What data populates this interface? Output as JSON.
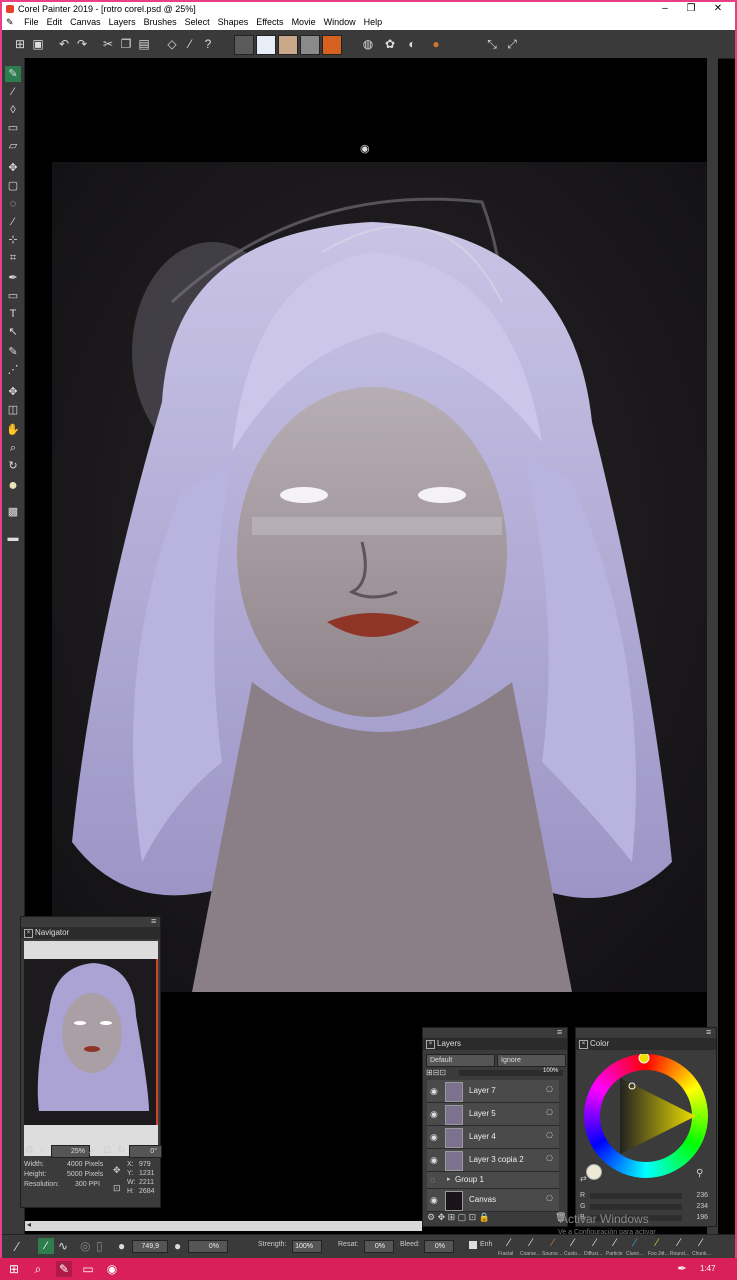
{
  "window": {
    "title": "Corel Painter 2019 - [rotro corel.psd @ 25%]",
    "controls": {
      "minimize": "–",
      "restore": "❐",
      "close": "✕"
    }
  },
  "menu": [
    "File",
    "Edit",
    "Canvas",
    "Layers",
    "Brushes",
    "Select",
    "Shapes",
    "Effects",
    "Movie",
    "Window",
    "Help"
  ],
  "colors": {
    "frame": "#e83f86",
    "taskbar": "#d9205b",
    "panel": "#3b3b3b",
    "accent_brush": "#2e7d4f"
  },
  "toolbar_icons": [
    "new-icon",
    "save-icon",
    "undo-icon",
    "redo-icon",
    "cut-icon",
    "copy-icon",
    "paste-icon",
    "eraser-icon",
    "brush-icon",
    "help-icon",
    "paper-icon",
    "media-icon",
    "texture-icon",
    "pattern-icon",
    "gradient-icon",
    "flow-icon",
    "weave-icon",
    "look-icon",
    "nozzle-icon",
    "mirror-icon",
    "symmetry-icon"
  ],
  "navigator": {
    "title": "Navigator",
    "zoom": "25%",
    "rotation": "0°",
    "width_label": "Width:",
    "width_value": "4000 Pixels",
    "height_label": "Height:",
    "height_value": "5000 Pixels",
    "resolution_label": "Resolution:",
    "resolution_value": "300 PPI",
    "x_label": "X:",
    "x_value": "979",
    "y_label": "Y:",
    "y_value": "1231",
    "w_label": "W:",
    "w_value": "2211",
    "h_label": "H:",
    "h_value": "2684"
  },
  "layers": {
    "title": "Layers",
    "blend_mode": "Default",
    "composite": "Ignore",
    "opacity": "100%",
    "items": [
      {
        "name": "Layer 7"
      },
      {
        "name": "Layer 5"
      },
      {
        "name": "Layer 4"
      },
      {
        "name": "Layer 3 copia 2"
      },
      {
        "name": "Group 1"
      },
      {
        "name": "Canvas"
      }
    ]
  },
  "color": {
    "title": "Color",
    "r_label": "R",
    "r": "236",
    "g_label": "G",
    "g": "234",
    "b_label": "B",
    "b": "196",
    "current": "#ecead4"
  },
  "propbar": {
    "size": "749,9",
    "opacity": "0%",
    "strength_label": "Strength:",
    "strength": "100%",
    "resat_label": "Resat:",
    "resat": "0%",
    "bleed_label": "Bleed:",
    "bleed": "0%",
    "enh": "Enh",
    "brush_categories": [
      "Fractal",
      "Coarse…",
      "Source…",
      "Custo…",
      "Diffusi…",
      "Particle",
      "Cluno…",
      "Foo Jitt…",
      "Round…",
      "Chunk…"
    ]
  },
  "watermark": {
    "line1": "Activar Windows",
    "line2": "Ve a Configuración para activar"
  },
  "taskbar": {
    "time": "1:47"
  }
}
